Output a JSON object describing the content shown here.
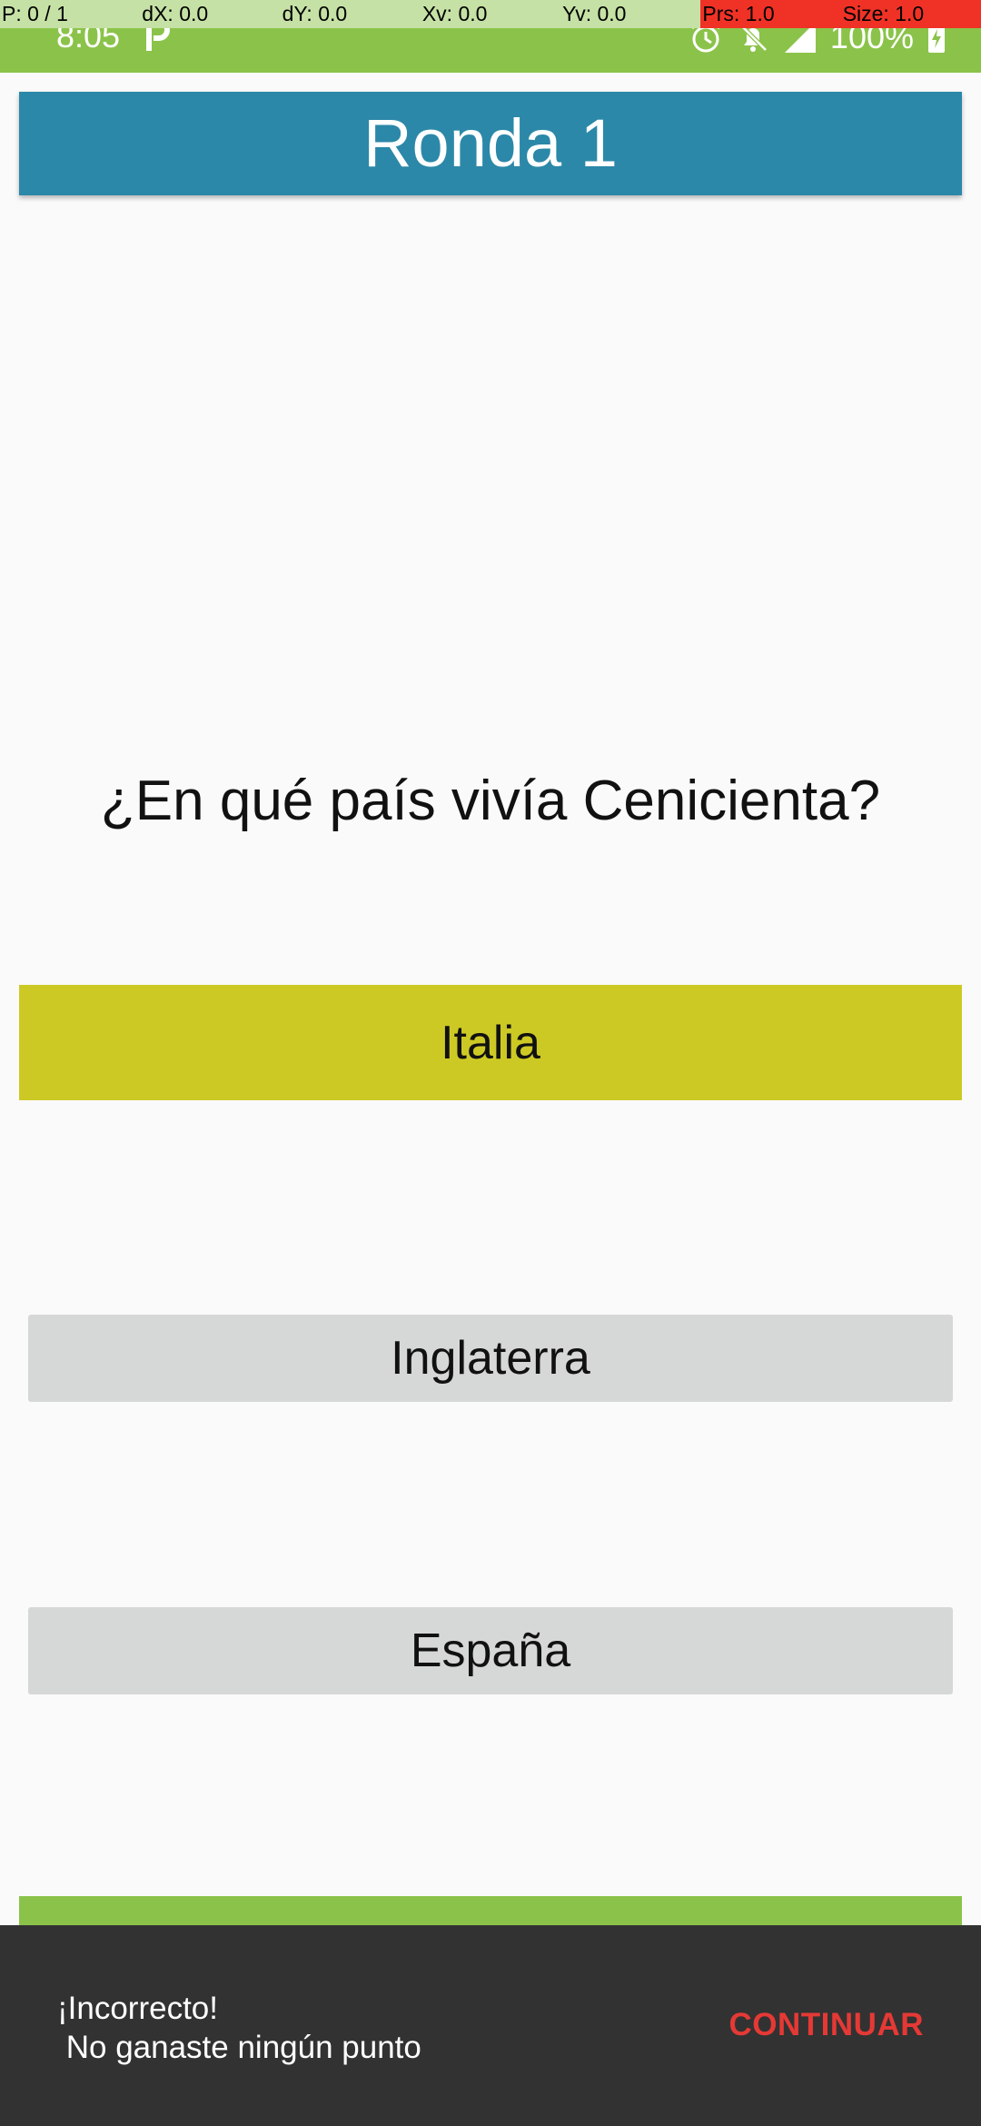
{
  "debug_overlay": {
    "pointer": "P: 0 / 1",
    "dx": "dX: 0.0",
    "dy": "dY: 0.0",
    "xv": "Xv: 0.0",
    "yv": "Yv: 0.0",
    "prs": "Prs: 1.0",
    "size": "Size: 1.0"
  },
  "status_bar": {
    "time": "8:05",
    "battery": "100%",
    "icons": [
      "parking-app-icon",
      "alarm-icon",
      "notifications-off-icon",
      "signal-icon",
      "battery-charging-icon"
    ]
  },
  "header": {
    "title": "Ronda 1"
  },
  "question": {
    "text": "¿En qué país vivía Cenicienta?"
  },
  "answers": [
    {
      "label": "Italia",
      "state": "selected"
    },
    {
      "label": "Inglaterra",
      "state": "default"
    },
    {
      "label": "España",
      "state": "default"
    }
  ],
  "snackbar": {
    "line1": "¡Incorrecto!",
    "line2": " No ganaste ningún punto",
    "action": "CONTINUAR"
  },
  "colors": {
    "status_bar": "#8bc34a",
    "header": "#2b88a8",
    "selected_answer": "#cdc924",
    "answer": "#d6d7d7",
    "snackbar": "#323232",
    "snackbar_action": "#e53935"
  }
}
